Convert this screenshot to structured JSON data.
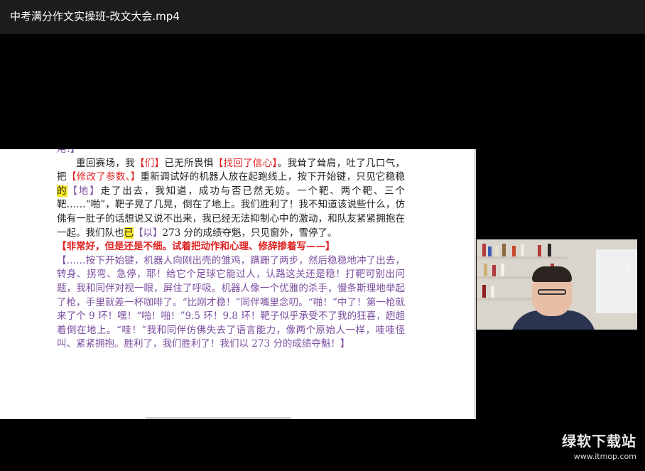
{
  "window": {
    "title": "中考满分作文实操班-改文大会.mp4"
  },
  "document": {
    "line0": "用!】",
    "para1": [
      {
        "t": "重回赛场，我",
        "c": "n"
      },
      {
        "t": "【们】",
        "c": "red"
      },
      {
        "t": "已无所畏惧",
        "c": "n"
      },
      {
        "t": "【找回了信心】",
        "c": "red"
      },
      {
        "t": "。我耸了耸肩，吐了几口气，把",
        "c": "n"
      },
      {
        "t": "【修改了参数、】",
        "c": "red"
      },
      {
        "t": "重新调试好的机器人放在起跑线上，按下开始键，只见它稳稳",
        "c": "n"
      },
      {
        "t": "的",
        "c": "hl"
      },
      {
        "t": "【地】",
        "c": "purple"
      },
      {
        "t": "走了出去，我知道，成功与否已然无妨。一个靶、两个靶、三个靶……“啪”，靶子晃了几晃，倒在了地上。我们胜利了！我不知道该说些什么，仿佛有一肚子的话想说又说不出来，我已经无法抑制心中的激动，和队友紧紧拥抱在一起。我们队也",
        "c": "n"
      },
      {
        "t": "已",
        "c": "hl"
      },
      {
        "t": "【以】",
        "c": "purple"
      },
      {
        "t": "273 分的成绩夺魁，只见窗外，雪停了。",
        "c": "n"
      }
    ],
    "comment": "【非常好，但是还是不细。试着把动作和心理、修辞掺着写——】",
    "rewrite": "【……按下开始键，机器人向刚出壳的雏鸡，蹒跚了两步，然后稳稳地冲了出去，转身、拐弯、急停，耶！给它个足球它能过人，认路这关还是稳！打靶可别出问题，我和同伴对视一眼，屏住了呼吸。机器人像一个优雅的杀手，慢条斯理地举起了枪，手里就差一杯咖啡了。“比刚才稳！”同伴嘴里念叨。“啪！”中了！第一枪就来了个 9 环！嘿！“啪！啪！”9.5 环！9.8 环！靶子似乎承受不了我的狂喜，趔趄着倒在地上。“哇！”我和同伴仿佛失去了语言能力，像两个原始人一样，哇哇怪叫、紧紧拥抱。胜利了，我们胜利了！我们以 273 分的成绩夺魁！】"
  },
  "webcam": {
    "nav_icon": "chevron-right-icon",
    "nav_glyph": "›"
  },
  "watermark": {
    "name": "绿软下载站",
    "url": "www.itmop.com"
  },
  "colors": {
    "red": "#e02020",
    "purple": "#7b4fa0",
    "highlight": "#f5e623"
  }
}
